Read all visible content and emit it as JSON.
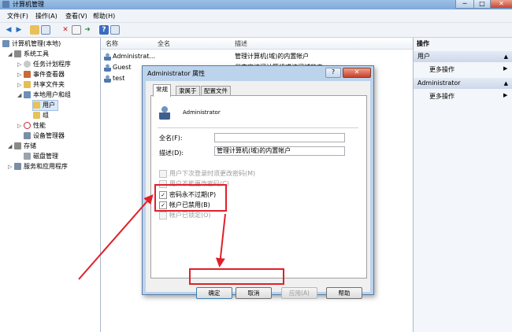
{
  "window": {
    "title": "计算机管理",
    "controls": [
      "─",
      "□",
      "✕"
    ]
  },
  "menu": [
    "文件(F)",
    "操作(A)",
    "查看(V)",
    "帮助(H)"
  ],
  "toolbar_icons": [
    "back-icon",
    "forward-icon",
    "up-folder-icon",
    "show-hide-tree-icon",
    "delete-icon",
    "properties-icon",
    "export-icon",
    "help-icon",
    "show-action-pane-icon"
  ],
  "tree": [
    {
      "label": "计算机管理(本地)",
      "expander": "",
      "icon": "computer-icon"
    },
    {
      "label": "系统工具",
      "expander": "◢",
      "icon": "tools-icon"
    },
    {
      "label": "任务计划程序",
      "expander": "▷",
      "icon": "clock-icon"
    },
    {
      "label": "事件查看器",
      "expander": "▷",
      "icon": "event-viewer-icon"
    },
    {
      "label": "共享文件夹",
      "expander": "▷",
      "icon": "shared-folder-icon"
    },
    {
      "label": "本地用户和组",
      "expander": "◢",
      "icon": "users-groups-icon"
    },
    {
      "label": "用户",
      "expander": "",
      "icon": "folder-icon"
    },
    {
      "label": "组",
      "expander": "",
      "icon": "folder-icon"
    },
    {
      "label": "性能",
      "expander": "▷",
      "icon": "performance-icon"
    },
    {
      "label": "设备管理器",
      "expander": "",
      "icon": "device-manager-icon"
    },
    {
      "label": "存储",
      "expander": "◢",
      "icon": "storage-icon"
    },
    {
      "label": "磁盘管理",
      "expander": "",
      "icon": "disk-icon"
    },
    {
      "label": "服务和应用程序",
      "expander": "▷",
      "icon": "services-icon"
    }
  ],
  "list": {
    "columns": [
      "名称",
      "全名",
      "描述"
    ],
    "rows": [
      {
        "name": "Administrat...",
        "fullname": "",
        "desc": "管理计算机(域)的内置帐户"
      },
      {
        "name": "Guest",
        "fullname": "",
        "desc": "供来宾访问计算机或访问域的内"
      },
      {
        "name": "test",
        "fullname": "",
        "desc": ""
      }
    ]
  },
  "actions": {
    "title": "操作",
    "sections": [
      {
        "header": "用户",
        "items": [
          "更多操作"
        ]
      },
      {
        "header": "Administrator",
        "items": [
          "更多操作"
        ]
      }
    ]
  },
  "dialog": {
    "title": "Administrator 属性",
    "help_btn": "?",
    "close_btn": "✕",
    "tabs": [
      "常规",
      "隶属于",
      "配置文件"
    ],
    "username": "Administrator",
    "fullname_label": "全名(F):",
    "fullname_value": "",
    "desc_label": "描述(D):",
    "desc_value": "管理计算机(域)的内置帐户",
    "checkboxes": [
      {
        "label": "用户下次登录时须更改密码(M)",
        "checked": false,
        "disabled": true
      },
      {
        "label": "用户不能更改密码(C)",
        "checked": false,
        "disabled": true
      },
      {
        "label": "密码永不过期(P)",
        "checked": true,
        "disabled": false
      },
      {
        "label": "帐户已禁用(B)",
        "checked": true,
        "disabled": false
      },
      {
        "label": "帐户已锁定(O)",
        "checked": false,
        "disabled": true
      }
    ],
    "buttons": [
      "确定",
      "取消",
      "应用(A)",
      "帮助"
    ]
  },
  "colors": {
    "annotation_red": "#e0202a",
    "title_blue": "#7ea9d9"
  }
}
